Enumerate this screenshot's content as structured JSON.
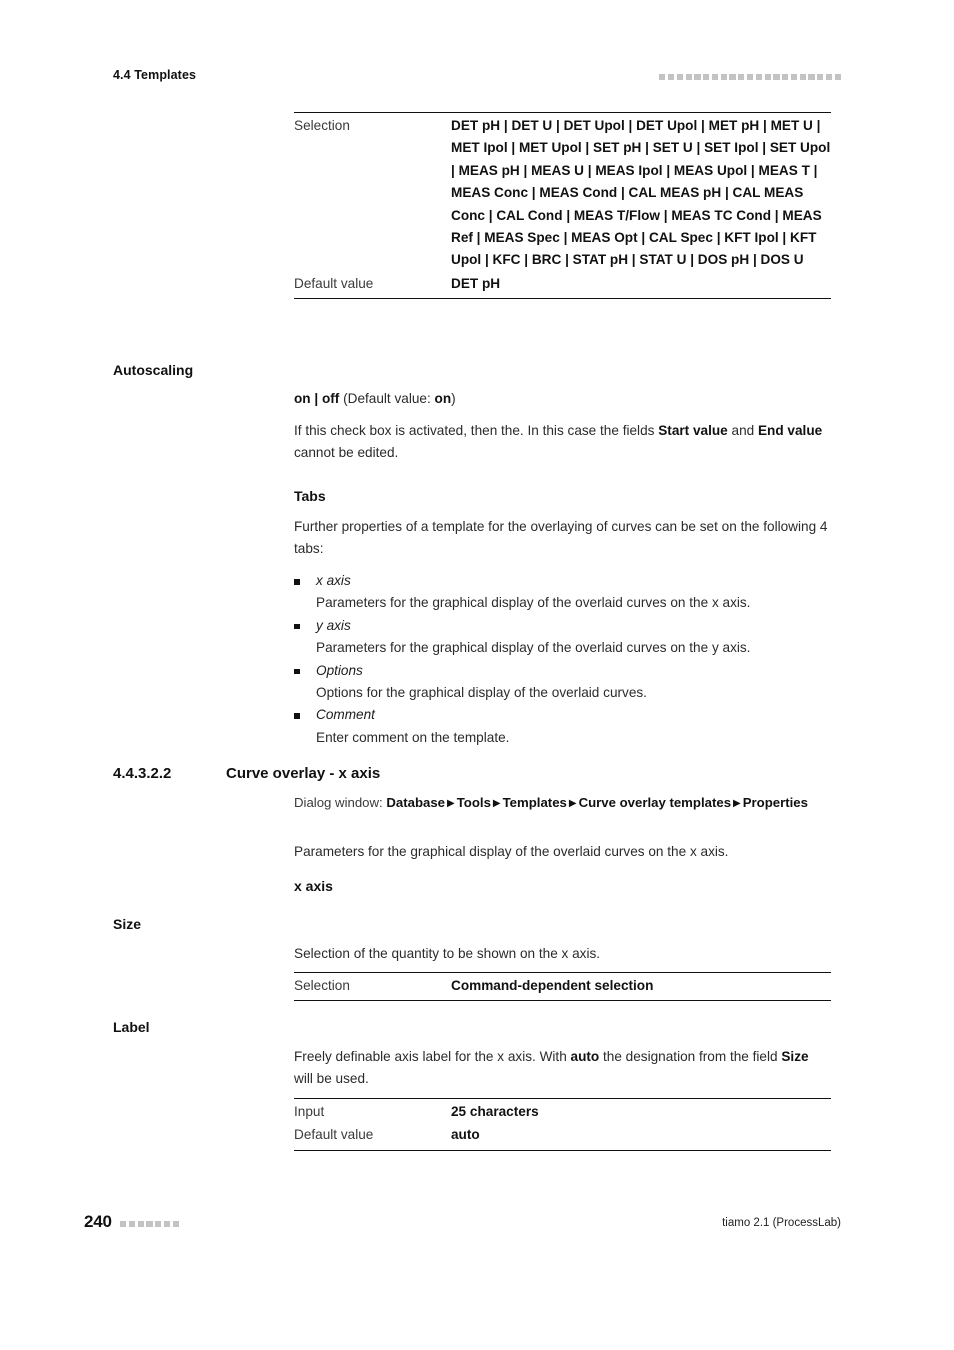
{
  "header": {
    "running_title": "4.4 Templates",
    "decor_squares": 21
  },
  "selection_table": {
    "rows": [
      {
        "key": "Selection",
        "value": "DET pH | DET U | DET Upol | DET Upol | MET pH | MET U | MET Ipol | MET Upol | SET pH | SET U | SET Ipol | SET Upol | MEAS pH | MEAS U | MEAS Ipol | MEAS Upol | MEAS T | MEAS Conc | MEAS Cond | CAL MEAS pH | CAL MEAS Conc | CAL Cond | MEAS T/Flow | MEAS TC Cond | MEAS Ref | MEAS Spec | MEAS Opt | CAL Spec | KFT Ipol | KFT Upol | KFC | BRC | STAT pH | STAT U | DOS pH | DOS U"
      },
      {
        "key": "Default value",
        "value": "DET pH"
      }
    ]
  },
  "autoscaling": {
    "label": "Autoscaling",
    "values_prefix": "on | off",
    "values_suffix_pre": " (Default value: ",
    "values_default": "on",
    "values_suffix_post": ")",
    "description_part1": "If this check box is activated, then the. In this case the fields ",
    "description_bold1": "Start value",
    "description_part2": " and ",
    "description_bold2": "End value",
    "description_part3": " cannot be edited."
  },
  "tabs": {
    "heading": "Tabs",
    "intro": "Further properties of a template for the overlaying of curves can be set on the following 4 tabs:",
    "items": [
      {
        "term": "x axis",
        "desc": "Parameters for the graphical display of the overlaid curves on the x axis."
      },
      {
        "term": "y axis",
        "desc": "Parameters for the graphical display of the overlaid curves on the y axis."
      },
      {
        "term": "Options",
        "desc": "Options for the graphical display of the overlaid curves."
      },
      {
        "term": "Comment",
        "desc": "Enter comment on the template."
      }
    ]
  },
  "section": {
    "number": "4.4.3.2.2",
    "title": "Curve overlay - x axis",
    "dialog_prefix": "Dialog window: ",
    "dialog_crumbs": [
      "Database",
      "Tools",
      "Templates",
      "Curve overlay templates",
      "Properties"
    ],
    "dialog_arrow": "▶",
    "intro": "Parameters for the graphical display of the overlaid curves on the x axis.",
    "tab_heading": "x axis"
  },
  "size": {
    "label": "Size",
    "description": "Selection of the quantity to be shown on the x axis.",
    "table": {
      "rows": [
        {
          "key": "Selection",
          "value": "Command-dependent selection"
        }
      ]
    }
  },
  "label_section": {
    "label": "Label",
    "description_part1": "Freely definable axis label for the x axis. With ",
    "description_bold1": "auto",
    "description_part2": " the designation from the field ",
    "description_bold2": "Size",
    "description_part3": " will be used.",
    "table": {
      "rows": [
        {
          "key": "Input",
          "value": "25 characters"
        },
        {
          "key": "Default value",
          "value": "auto"
        }
      ]
    }
  },
  "footer": {
    "page_number": "240",
    "decor_squares": 7,
    "product": "tiamo 2.1 (ProcessLab)"
  }
}
